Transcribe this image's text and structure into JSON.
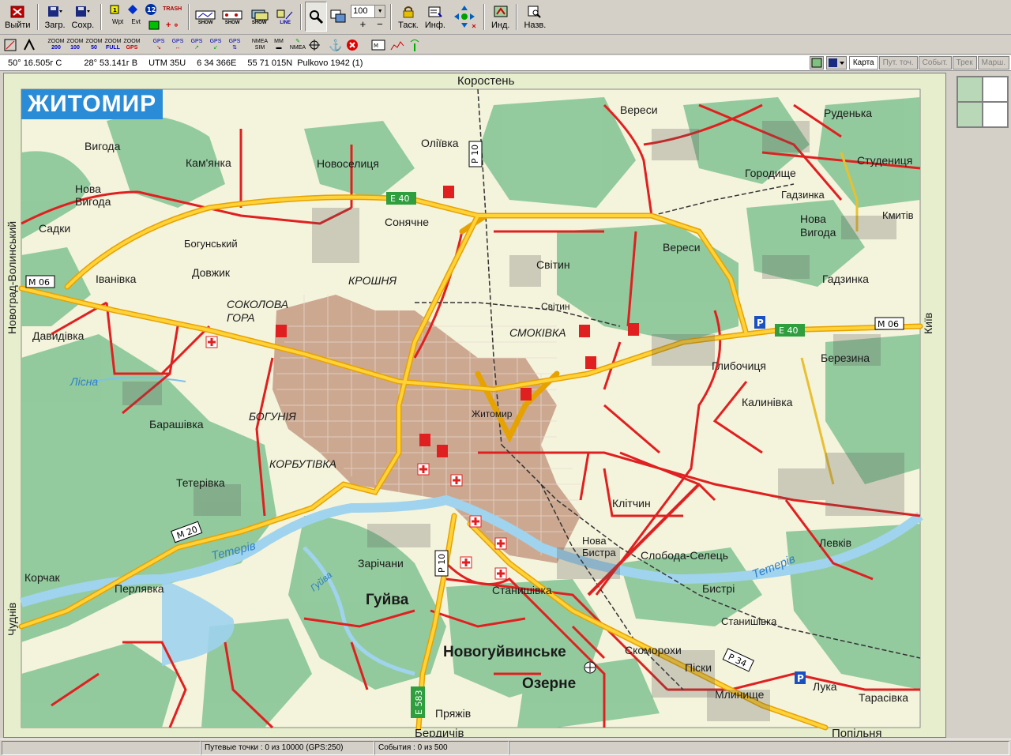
{
  "toolbar": {
    "exit_label": "Выйти",
    "load_label": "Загр.",
    "save_label": "Сохр.",
    "wpt_label": "Wpt",
    "evt_label": "Evt",
    "zoom_value": "100",
    "task_label": "Таск.",
    "info_label": "Инф.",
    "ind_label": "Инд.",
    "name_label": "Назв.",
    "trash_label": "TRASH",
    "show_label": "SHOW",
    "line_label": "LINE"
  },
  "toolbar2": {
    "zoom_buttons": [
      {
        "top": "ZOOM",
        "bottom": "200"
      },
      {
        "top": "ZOOM",
        "bottom": "100"
      },
      {
        "top": "ZOOM",
        "bottom": "50"
      },
      {
        "top": "ZOOM",
        "bottom": "FULL"
      },
      {
        "top": "ZOOM",
        "bottom": "GPS"
      }
    ],
    "gps_buttons": [
      "GPS",
      "GPS",
      "GPS",
      "GPS",
      "GPS"
    ],
    "nmea_sim": "NMEA SIM",
    "mm": "MM",
    "nmea": "NMEA"
  },
  "coordinates": {
    "lat": "50° 16.505г С",
    "lon": "28° 53.141г В",
    "utm": "UTM  35U",
    "easting": "6 34 366E",
    "northing": "55 71 015N",
    "datum": "Pulkovo 1942 (1)"
  },
  "tabs": [
    {
      "label": "Карта",
      "active": true
    },
    {
      "label": "Пут. точ.",
      "active": false
    },
    {
      "label": "Событ.",
      "active": false
    },
    {
      "label": "Трек",
      "active": false
    },
    {
      "label": "Марш.",
      "active": false
    }
  ],
  "map": {
    "city_title": "ЖИТОМИР",
    "labels": {
      "korosten": "Коростень",
      "kyiv": "Київ",
      "novograd": "Новоград-Волинський",
      "chudniv": "Чуднів",
      "berdychiv": "Бердичів",
      "popilnia": "Попільня",
      "vyhoda": "Вигода",
      "nova_vyhoda": "Нова Вигода",
      "kamianka": "Кам'янка",
      "novoselytsia": "Новоселиця",
      "oliivka": "Оліївка",
      "veresy_n": "Вереси",
      "rudenka": "Руденька",
      "studenytsia": "Студениця",
      "horodyshche": "Городище",
      "hadzynka_n": "Гадзинка",
      "kmytiv": "Кмитів",
      "nova_vyhoda_e": "Нова Вигода",
      "hadzynka_s": "Гадзинка",
      "sadky": "Садки",
      "bohunskyi": "Богунський",
      "sonyachne": "Сонячне",
      "svityn_n": "Світин",
      "veresy_s": "Вереси",
      "ivanivka": "Іванівка",
      "dovzhyk": "Довжик",
      "kroshnia": "КРОШНЯ",
      "svityn_s": "Світин",
      "sokolova_hora": "СОКОЛОВА ГОРА",
      "smokivka": "СМОКІВКА",
      "davydivka": "Давидівка",
      "hlybochytsia": "Глибочиця",
      "berezyna": "Березина",
      "lisna": "Лісна",
      "barashivka": "Барашівка",
      "bohuniia": "БОГУНІЯ",
      "zhytomyr": "Житомир",
      "kalynivka": "Калинівка",
      "korbutivka": "КОРБУТІВКА",
      "teterivka": "Тетерівка",
      "klitchyn": "Клітчин",
      "korchak": "Корчак",
      "perliavka": "Перлявка",
      "teteriv_w": "Тетерів",
      "zarichany": "Зарічани",
      "nova_bystra": "Нова Бистра",
      "sloboda": "Слобода-Селець",
      "bystri": "Бистрі",
      "teteriv_e": "Тетерів",
      "levkiv": "Левків",
      "huiva_river": "Гуйва",
      "huiva": "Гуйва",
      "stanyshivka": "Станишівка",
      "stanyshivka_e": "Станишівка",
      "novohuivynske": "Новогуйвинське",
      "skomorokhy": "Скоморохи",
      "pisky": "Піски",
      "ozerne": "Озерне",
      "mlynyshche": "Млинище",
      "luka": "Лука",
      "tarasivka": "Тарасівка",
      "priazhiv": "Пряжів"
    },
    "road_labels": {
      "e40_n": "Е 40",
      "e40_e": "Е 40",
      "m06_w": "М 06",
      "m06_e": "М 06",
      "p10_n": "Р 10",
      "p10_s": "Р 10",
      "m20": "М 20",
      "p34": "Р 34",
      "e583": "Е 583"
    }
  },
  "status": {
    "waypoints": "Путевые точки : 0 из 10000  (GPS:250)",
    "events": "События : 0 из 500"
  }
}
